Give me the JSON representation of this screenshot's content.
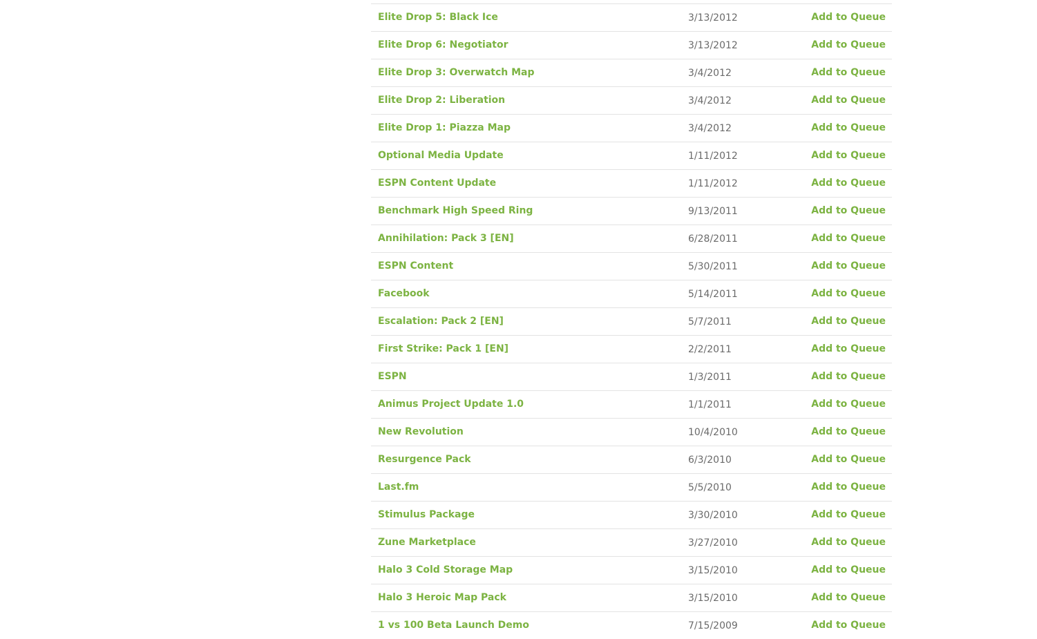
{
  "colors": {
    "link_green": "#7cb342",
    "date_gray": "#6a6a6a",
    "divider": "#e3e3e3"
  },
  "action_label": "Add to Queue",
  "items": [
    {
      "title": "Elite Drop 5: Black Ice",
      "date": "3/13/2012"
    },
    {
      "title": "Elite Drop 6: Negotiator",
      "date": "3/13/2012"
    },
    {
      "title": "Elite Drop 3: Overwatch Map",
      "date": "3/4/2012"
    },
    {
      "title": "Elite Drop 2: Liberation",
      "date": "3/4/2012"
    },
    {
      "title": "Elite Drop 1: Piazza Map",
      "date": "3/4/2012"
    },
    {
      "title": "Optional Media Update",
      "date": "1/11/2012"
    },
    {
      "title": "ESPN Content Update",
      "date": "1/11/2012"
    },
    {
      "title": "Benchmark High Speed Ring",
      "date": "9/13/2011"
    },
    {
      "title": "Annihilation: Pack 3 [EN]",
      "date": "6/28/2011"
    },
    {
      "title": "ESPN Content",
      "date": "5/30/2011"
    },
    {
      "title": "Facebook",
      "date": "5/14/2011"
    },
    {
      "title": "Escalation: Pack 2 [EN]",
      "date": "5/7/2011"
    },
    {
      "title": "First Strike: Pack 1 [EN]",
      "date": "2/2/2011"
    },
    {
      "title": "ESPN",
      "date": "1/3/2011"
    },
    {
      "title": "Animus Project Update 1.0",
      "date": "1/1/2011"
    },
    {
      "title": "New Revolution",
      "date": "10/4/2010"
    },
    {
      "title": "Resurgence Pack",
      "date": "6/3/2010"
    },
    {
      "title": "Last.fm",
      "date": "5/5/2010"
    },
    {
      "title": "Stimulus Package",
      "date": "3/30/2010"
    },
    {
      "title": "Zune Marketplace",
      "date": "3/27/2010"
    },
    {
      "title": "Halo 3 Cold Storage Map",
      "date": "3/15/2010"
    },
    {
      "title": "Halo 3 Heroic Map Pack",
      "date": "3/15/2010"
    },
    {
      "title": "1 vs 100 Beta Launch Demo",
      "date": "7/15/2009"
    }
  ]
}
